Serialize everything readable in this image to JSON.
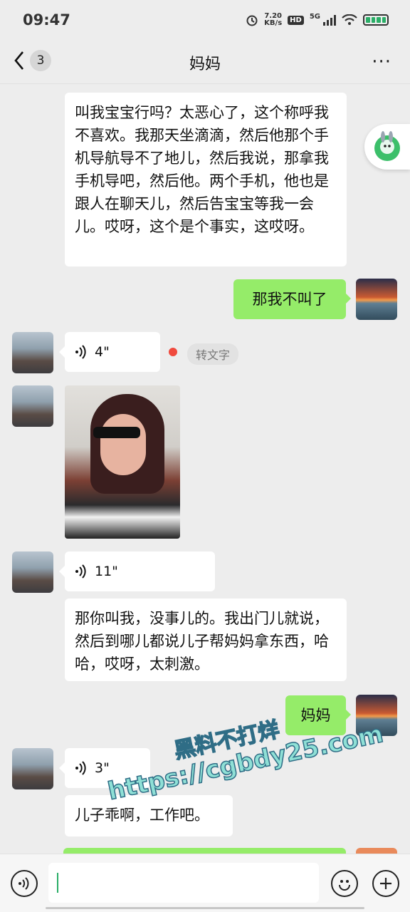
{
  "status": {
    "time": "09:47",
    "speed_value": "7.20",
    "speed_unit": "KB/s",
    "hd": "HD",
    "network": "5G"
  },
  "header": {
    "unread": "3",
    "title": "妈妈",
    "more": "···"
  },
  "messages": [
    {
      "from": "mom",
      "type": "text",
      "text": "叫我宝宝行吗？太恶心了，这个称呼我不喜欢。我那天坐滴滴，然后他那个手机导航导不了地儿，然后我说，那拿我手机导吧，然后他。两个手机，他也是跟人在聊天儿，然后告宝宝等我一会儿。哎呀，这个是个事实，这哎呀。"
    },
    {
      "from": "me",
      "type": "text",
      "text": "那我不叫了"
    },
    {
      "from": "mom",
      "type": "voice",
      "duration": "4\"",
      "to_text": "转文字"
    },
    {
      "from": "mom",
      "type": "image"
    },
    {
      "from": "mom",
      "type": "voice",
      "duration": "11\""
    },
    {
      "from": "mom",
      "type": "text",
      "text": "那你叫我，没事儿的。我出门儿就说，然后到哪儿都说儿子帮妈妈拿东西，哈哈，哎呀，太刺激。"
    },
    {
      "from": "me",
      "type": "text",
      "text": "妈妈"
    },
    {
      "from": "mom",
      "type": "voice",
      "duration": "3\""
    },
    {
      "from": "mom",
      "type": "text",
      "text": "儿子乖啊，工作吧。"
    }
  ],
  "watermark": {
    "line1": "黑料不打烊",
    "line2": "https://cgbdy25.com"
  },
  "input_bar": {
    "placeholder": "",
    "icons": [
      "voice-icon",
      "emoji-icon",
      "plus-icon"
    ]
  },
  "colors": {
    "my_bubble": "#95ec69",
    "their_bubble": "#ffffff",
    "background": "#ededed"
  }
}
